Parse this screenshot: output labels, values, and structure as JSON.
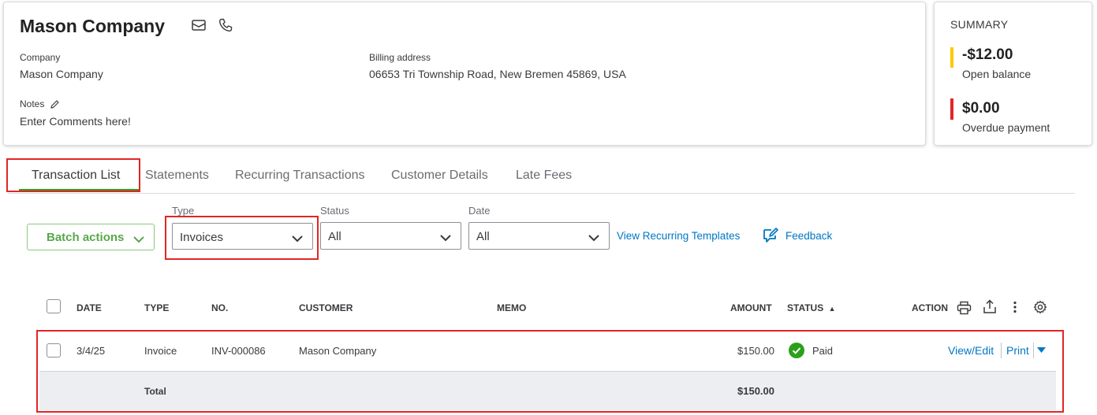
{
  "customer": {
    "name": "Mason Company",
    "company_label": "Company",
    "company_value": "Mason Company",
    "billing_label": "Billing address",
    "billing_value": "06653 Tri Township Road, New Bremen 45869, USA",
    "notes_label": "Notes",
    "notes_value": "Enter Comments here!"
  },
  "summary": {
    "title": "SUMMARY",
    "open_balance_amount": "-$12.00",
    "open_balance_label": "Open balance",
    "overdue_amount": "$0.00",
    "overdue_label": "Overdue payment",
    "colors": {
      "open": "#ffc800",
      "overdue": "#e32526"
    }
  },
  "tabs": [
    {
      "label": "Transaction List",
      "active": true
    },
    {
      "label": "Statements"
    },
    {
      "label": "Recurring Transactions"
    },
    {
      "label": "Customer Details"
    },
    {
      "label": "Late Fees"
    }
  ],
  "filters": {
    "batch_label": "Batch actions",
    "type_label": "Type",
    "type_value": "Invoices",
    "status_label": "Status",
    "status_value": "All",
    "date_label": "Date",
    "date_value": "All",
    "recurring_link": "View Recurring Templates",
    "feedback_link": "Feedback"
  },
  "table": {
    "headers": {
      "date": "DATE",
      "type": "TYPE",
      "no": "NO.",
      "customer": "CUSTOMER",
      "memo": "MEMO",
      "amount": "AMOUNT",
      "status": "STATUS",
      "sort_arrow": "▲",
      "action": "ACTION"
    },
    "rows": [
      {
        "date": "3/4/25",
        "type": "Invoice",
        "no": "INV-000086",
        "customer": "Mason Company",
        "memo": "",
        "amount": "$150.00",
        "status": "Paid",
        "action_view": "View/Edit",
        "action_print": "Print"
      }
    ],
    "total_label": "Total",
    "total_amount": "$150.00"
  },
  "colors": {
    "accent_green": "#2ca01c",
    "link_blue": "#0077c5",
    "highlight_red": "#e32526"
  }
}
